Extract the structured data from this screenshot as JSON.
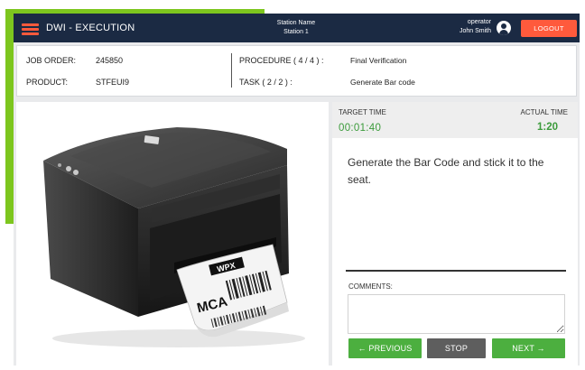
{
  "header": {
    "menu_icon": "hamburger-menu-icon",
    "app_title": "DWI - EXECUTION",
    "station_label": "Station Name",
    "station_value": "Station 1",
    "operator_label": "operator",
    "operator_name": "John Smith",
    "user_icon": "user-circle-icon",
    "logout_label": "LOGOUT"
  },
  "job": {
    "job_order_label": "JOB ORDER:",
    "job_order_value": "245850",
    "product_label": "PRODUCT:",
    "product_value": "STFEUI9",
    "procedure_label": "PROCEDURE ( 4 / 4 ) :",
    "procedure_value": "Final Verification",
    "task_label": "TASK ( 2 / 2 ) :",
    "task_value": "Generate Bar code"
  },
  "image": {
    "label_brand": "WPX",
    "label_text": "MCA"
  },
  "timing": {
    "target_label": "TARGET TIME",
    "target_value": "00:01:40",
    "actual_label": "ACTUAL TIME",
    "actual_value": "1:20"
  },
  "instruction": "Generate the Bar Code and stick it to the seat.",
  "comments": {
    "label": "COMMENTS:",
    "value": ""
  },
  "buttons": {
    "previous": "← PREVIOUS",
    "stop": "STOP",
    "next": "NEXT →"
  },
  "colors": {
    "header_bg": "#1b2a43",
    "accent_orange": "#ff5a3c",
    "action_green": "#4caf3f",
    "time_green": "#3b9b3b",
    "frame_lime": "#7dc61e"
  }
}
